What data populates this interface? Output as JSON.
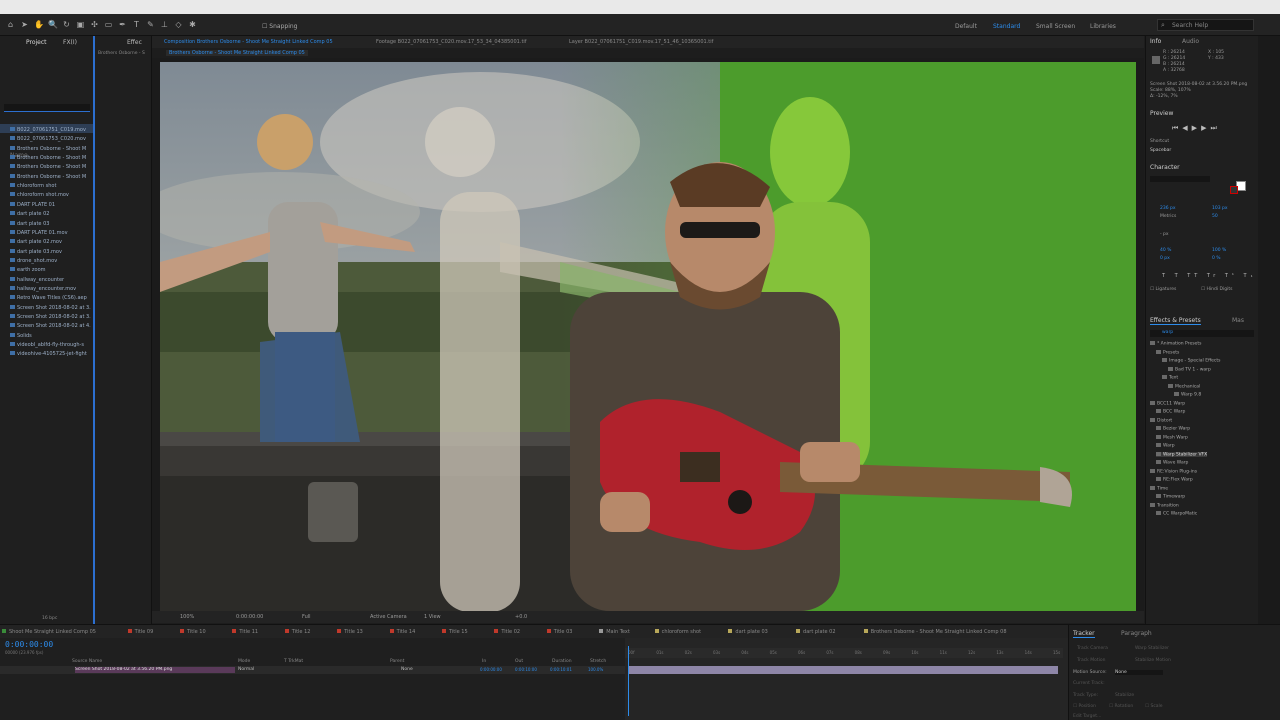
{
  "toolbar": {
    "snapping_label": "Snapping",
    "workspaces": [
      "Default",
      "Standard",
      "Small Screen",
      "Libraries"
    ],
    "active_workspace": "Standard",
    "search_placeholder": "Search Help"
  },
  "project_panel": {
    "tabs": [
      "Project",
      "FX(I)",
      "Effec"
    ],
    "header": "Name",
    "items": [
      "B022_07061751_C019.mov",
      "B022_07061753_C020.mov",
      "Brothers Osborne - Shoot M",
      "Brothers Osborne - Shoot M",
      "Brothers Osborne - Shoot M",
      "Brothers Osborne - Shoot M",
      "chloroform shot",
      "chloroform shot.mov",
      "DART PLATE 01",
      "dart plate 02",
      "dart plate 03",
      "DART PLATE 01.mov",
      "dart plate 02.mov",
      "dart plate 03.mov",
      "drone_shot.mov",
      "earth zoom",
      "hallway_encounter",
      "hallway_encounter.mov",
      "Retro Wave Titles (CS6).aep",
      "Screen Shot 2018-08-02 at 3.",
      "Screen Shot 2018-08-02 at 3.",
      "Screen Shot 2018-08-02 at 4.",
      "Solids",
      "videobl_ablfd-fly-through-s",
      "videohive-4105725-jet-fight"
    ],
    "footer_label": "16 bpc"
  },
  "effects_strip": {
    "label": "Brothers Osborne - S"
  },
  "viewer": {
    "tabs": [
      "Composition Brothers Osborne - Shoot Me Straight Linked Comp 05",
      "Footage B022_07061753_C020.mov.17_53_34_04385001.tif",
      "Layer B022_07061751_C019.mov.17_51_46_10365001.tif"
    ],
    "active_tab_index": 0,
    "breadcrumb": "Brothers Osborne - Shoot Me Straight Linked Comp 05",
    "zoom": "100%",
    "timecode": "0:00:00:00",
    "resolution": "Full",
    "camera": "Active Camera",
    "views": "1 View",
    "exposure": "+0.0"
  },
  "info_panel": {
    "tabs": [
      "Info",
      "Audio"
    ],
    "rgb": [
      "R : 26214",
      "G : 26214",
      "B : 26214",
      "A : 32768"
    ],
    "coords": [
      "X : 105",
      "Y : 433"
    ],
    "details": [
      "Screen Shot 2018-08-02 at 3.56.20 PM.png",
      "Scale: 88%, 107%",
      "Δ: -12%, 7%"
    ]
  },
  "preview_panel": {
    "title": "Preview",
    "shortcut_label": "Shortcut",
    "shortcut_value": "Spacebar"
  },
  "character_panel": {
    "title": "Character",
    "font_size": "236 px",
    "leading": "103 px",
    "tracking": "50",
    "kerning": "Metrics",
    "vscale": "40 %",
    "hscale": "100 %",
    "baseline": "0 px",
    "tsume": "0 %",
    "unit": "- px",
    "ligatures": "Ligatures",
    "hindi_digits": "Hindi Digits"
  },
  "effects_presets": {
    "tabs": [
      "Effects & Presets",
      "Mas"
    ],
    "search_value": "warp",
    "tree": [
      {
        "label": "* Animation Presets",
        "depth": 0
      },
      {
        "label": "Presets",
        "depth": 1
      },
      {
        "label": "Image - Special Effects",
        "depth": 2
      },
      {
        "label": "Bad TV 1 - warp",
        "depth": 3
      },
      {
        "label": "Text",
        "depth": 2
      },
      {
        "label": "Mechanical",
        "depth": 3
      },
      {
        "label": "Warp 9.8",
        "depth": 4
      },
      {
        "label": "BCC11 Warp",
        "depth": 0
      },
      {
        "label": "BCC Warp",
        "depth": 1
      },
      {
        "label": "Distort",
        "depth": 0
      },
      {
        "label": "Bezier Warp",
        "depth": 1
      },
      {
        "label": "Mesh Warp",
        "depth": 1
      },
      {
        "label": "Warp",
        "depth": 1
      },
      {
        "label": "Warp Stabilizer VFX",
        "depth": 1
      },
      {
        "label": "Wave Warp",
        "depth": 1
      },
      {
        "label": "RE:Vision Plug-ins",
        "depth": 0
      },
      {
        "label": "RE:Flex Warp",
        "depth": 1
      },
      {
        "label": "Time",
        "depth": 0
      },
      {
        "label": "Timewarp",
        "depth": 1
      },
      {
        "label": "Transition",
        "depth": 0
      },
      {
        "label": "CC WarpoMatic",
        "depth": 1
      }
    ],
    "selected_index": 13
  },
  "timeline": {
    "tabs": [
      {
        "label": "Shoot Me Straight Linked Comp 05",
        "color": "#3a8c3a"
      },
      {
        "label": "Title 09",
        "color": "#c0392b"
      },
      {
        "label": "Title 10",
        "color": "#c0392b"
      },
      {
        "label": "Title 11",
        "color": "#c0392b"
      },
      {
        "label": "Title 12",
        "color": "#c0392b"
      },
      {
        "label": "Title 13",
        "color": "#c0392b"
      },
      {
        "label": "Title 14",
        "color": "#c0392b"
      },
      {
        "label": "Title 15",
        "color": "#c0392b"
      },
      {
        "label": "Title 02",
        "color": "#c0392b"
      },
      {
        "label": "Title 03",
        "color": "#c0392b"
      },
      {
        "label": "Main Text",
        "color": "#9a9a9a"
      },
      {
        "label": "chloroform shot",
        "color": "#b8a85a"
      },
      {
        "label": "dart plate 03",
        "color": "#b8a85a"
      },
      {
        "label": "dart plate 02",
        "color": "#b8a85a"
      },
      {
        "label": "Brothers Osborne - Shoot Me Straight Linked Comp 08",
        "color": "#b8a85a"
      }
    ],
    "timecode": "0:00:00:00",
    "frame_info": "00000 (23.976 fps)",
    "columns": [
      "Source Name",
      "Mode",
      "T TrkMat",
      "Parent",
      "In",
      "Out",
      "Duration",
      "Stretch"
    ],
    "layer": {
      "name": "Screen Shot 2018-08-02 at 3.56.20 PM.png",
      "mode": "Normal",
      "parent": "None",
      "in": "0:00:00:00",
      "out": "0:00:10:00",
      "duration": "0:00:10:01",
      "stretch": "100.0%"
    },
    "ruler": [
      "00f",
      "01s",
      "02s",
      "03s",
      "04s",
      "05s",
      "06s",
      "07s",
      "08s",
      "09s",
      "10s",
      "11s",
      "12s",
      "13s",
      "14s",
      "15s"
    ]
  },
  "tracker_panel": {
    "tabs": [
      "Tracker",
      "Paragraph"
    ],
    "buttons": [
      "Track Camera",
      "Warp Stabilizer",
      "Track Motion",
      "Stabilize Motion"
    ],
    "motion_source_label": "Motion Source:",
    "motion_source": "None",
    "fields": [
      "Current Track:",
      "Track Type:",
      "Stabilize"
    ],
    "checkboxes": [
      "Position",
      "Rotation",
      "Scale"
    ],
    "edit_target": "Edit Target..."
  }
}
